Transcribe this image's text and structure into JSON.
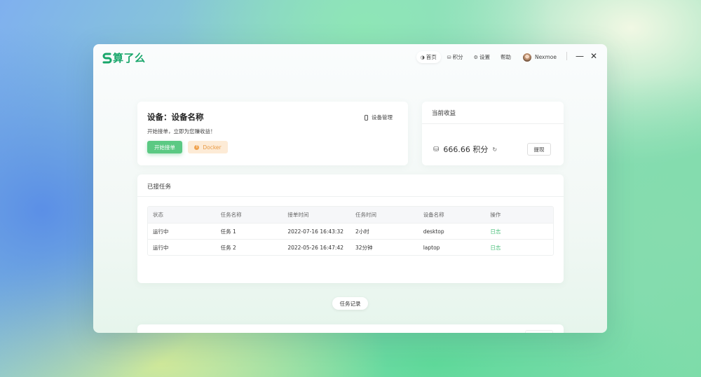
{
  "app": {
    "logo_text": "算了么",
    "brand_color": "#18a66a"
  },
  "nav": {
    "items": [
      {
        "label": "首页",
        "icon": "home-icon",
        "active": true
      },
      {
        "label": "积分",
        "icon": "points-icon",
        "active": false
      },
      {
        "label": "设置",
        "icon": "gear-icon",
        "active": false
      },
      {
        "label": "帮助",
        "icon": "",
        "active": false
      }
    ],
    "user": {
      "name": "Nexmoe"
    }
  },
  "device": {
    "title": "设备：设备名称",
    "subtitle": "开始接单，立即为您赚收益！",
    "manage_label": "设备管理",
    "start_label": "开始接单",
    "docker_label": "Docker"
  },
  "earnings": {
    "title": "当前收益",
    "value": "666.66 积分",
    "withdraw_label": "提现"
  },
  "tasks": {
    "title": "已接任务",
    "columns": [
      "状态",
      "任务名称",
      "接单时间",
      "任务时间",
      "设备名称",
      "操作"
    ],
    "rows": [
      [
        "运行中",
        "任务 1",
        "2022-07-16 16:43:32",
        "2小时",
        "desktop",
        "日志"
      ],
      [
        "运行中",
        "任务 2",
        "2022-05-26 16:47:42",
        "32分钟",
        "laptop",
        "日志"
      ]
    ]
  },
  "records_label": "任务记录",
  "colors": {
    "primary_green": "#5bc983",
    "link_green": "#4cc07c",
    "docker_bg": "#fdebd6",
    "docker_text": "#e89a45"
  }
}
